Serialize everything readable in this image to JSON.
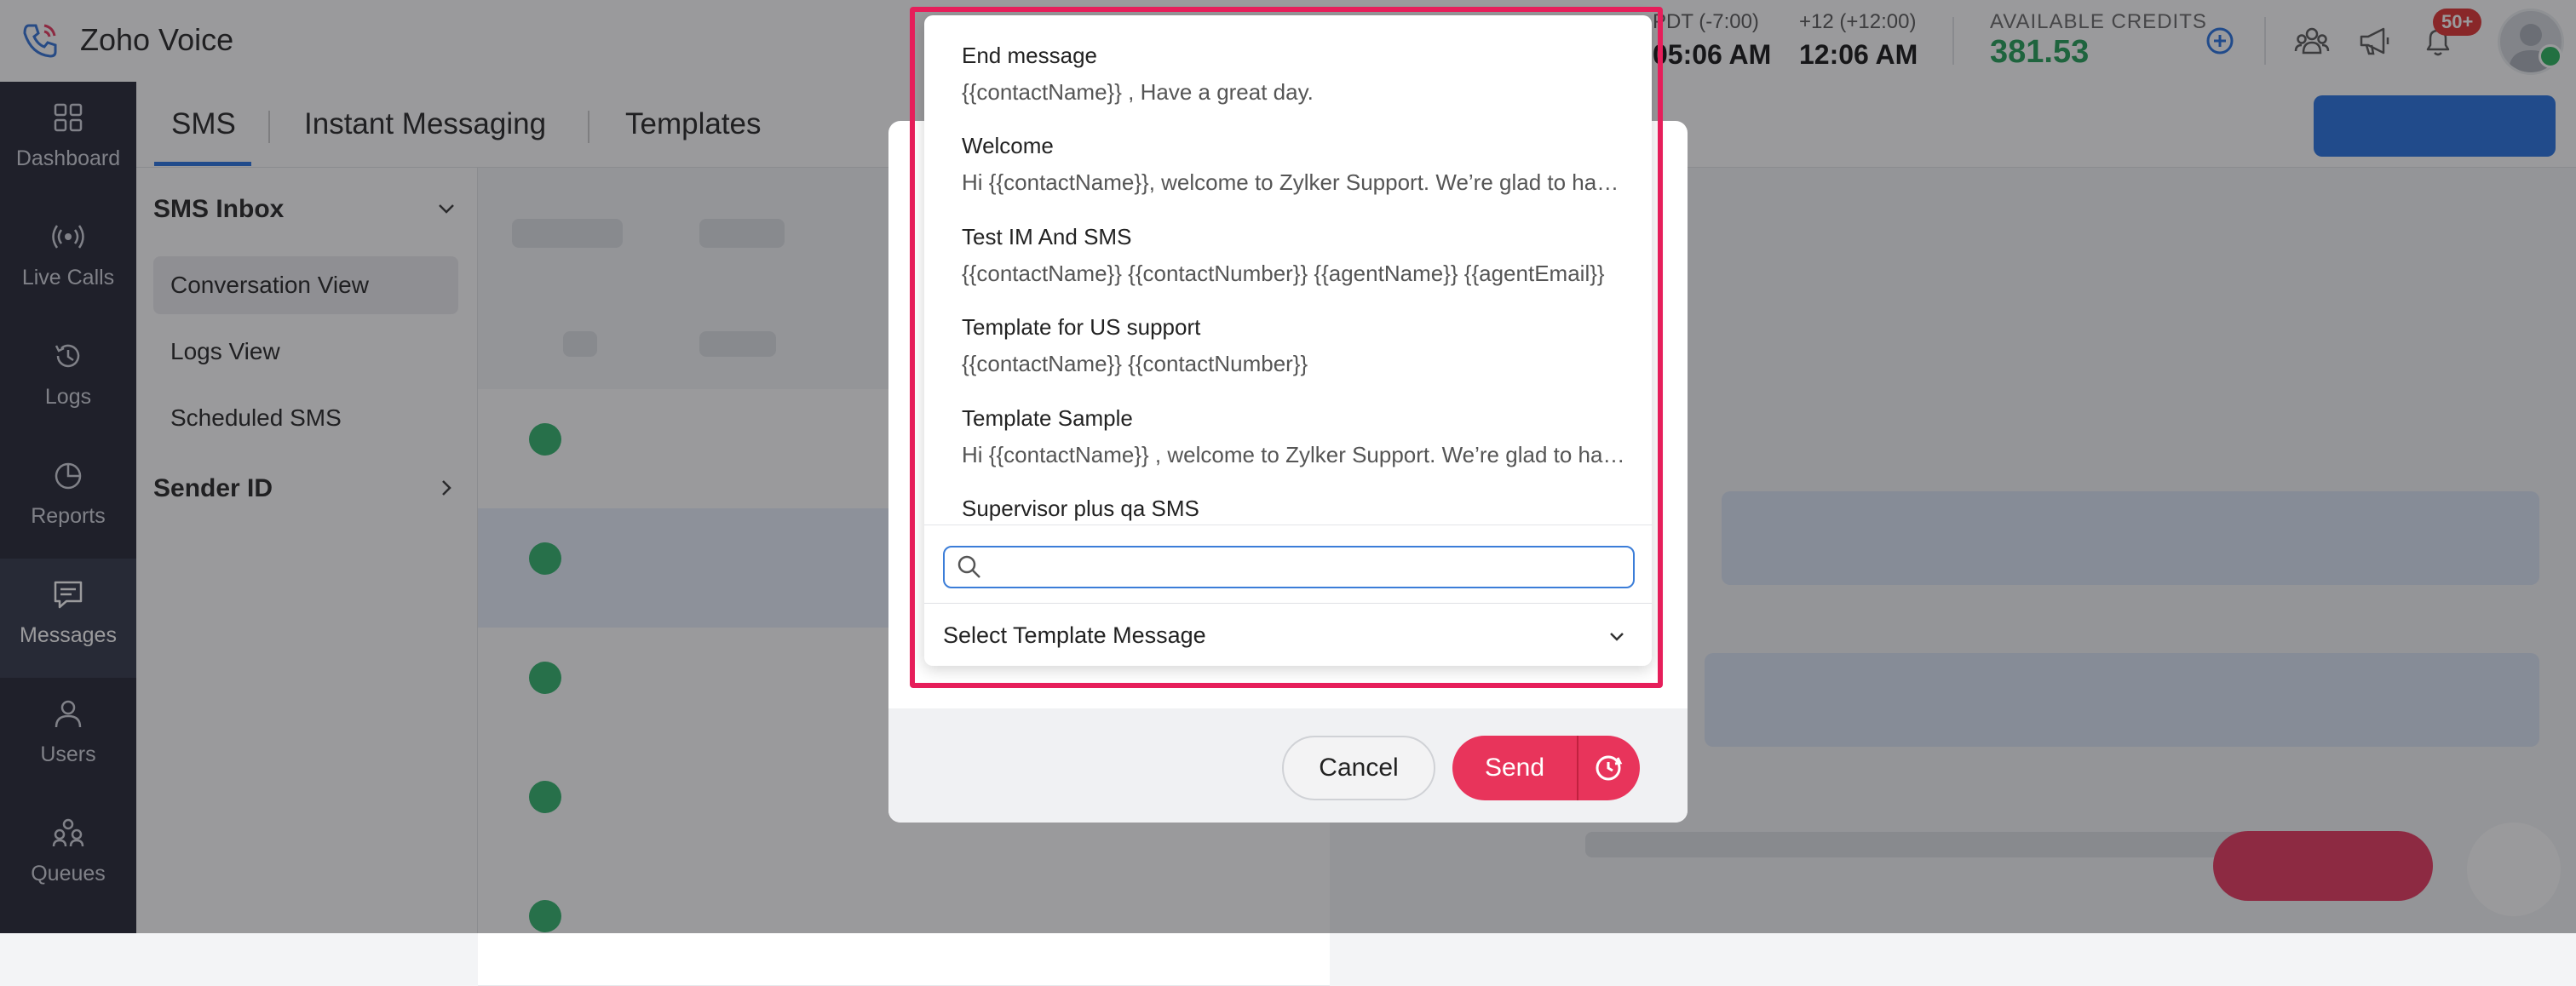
{
  "app": {
    "name": "Zoho Voice"
  },
  "topbar": {
    "clocks": [
      {
        "label": "PDT (-7:00)",
        "time": "05:06 AM"
      },
      {
        "label": "+12 (+12:00)",
        "time": "12:06 AM"
      }
    ],
    "credits_label": "AVAILABLE CREDITS",
    "credits_value": "381.53",
    "notification_count": "50+"
  },
  "rail": [
    {
      "label": "Dashboard"
    },
    {
      "label": "Live Calls"
    },
    {
      "label": "Logs"
    },
    {
      "label": "Reports"
    },
    {
      "label": "Messages",
      "active": true
    },
    {
      "label": "Users"
    },
    {
      "label": "Queues"
    }
  ],
  "tabs": [
    "SMS",
    "Instant Messaging",
    "Templates"
  ],
  "inbox": {
    "heading": "SMS Inbox",
    "items": [
      "Conversation View",
      "Logs View",
      "Scheduled SMS"
    ],
    "sender_heading": "Sender ID"
  },
  "dropdown": {
    "options": [
      {
        "title": "End message",
        "body": "{{contactName}} , Have a great day."
      },
      {
        "title": "Welcome",
        "body": "Hi {{contactName}}, welcome to Zylker Support. We’re glad to have you here."
      },
      {
        "title": "Test IM And SMS",
        "body": "{{contactName}} {{contactNumber}} {{agentName}} {{agentEmail}}"
      },
      {
        "title": "Template for US support",
        "body": "{{contactName}} {{contactNumber}}"
      },
      {
        "title": "Template Sample",
        "body": "Hi {{contactName}} , welcome to Zylker Support. We’re glad to have you here."
      },
      {
        "title": "Supervisor plus qa SMS",
        "body": ""
      }
    ],
    "search_placeholder": "",
    "select_label": "Select Template Message"
  },
  "modal": {
    "cancel_label": "Cancel",
    "send_label": "Send"
  },
  "colors": {
    "accent": "#2370e0",
    "send": "#e8345b",
    "highlight": "#e61e5a",
    "credits": "#1f9d55",
    "rail": "#1f2230"
  }
}
